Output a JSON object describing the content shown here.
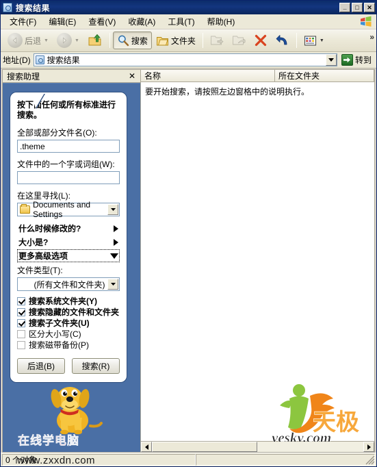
{
  "window": {
    "title": "搜索结果",
    "controls": {
      "minimize": "_",
      "maximize": "□",
      "close": "✕"
    }
  },
  "menu": {
    "items": [
      {
        "label": "文件(F)"
      },
      {
        "label": "编辑(E)"
      },
      {
        "label": "查看(V)"
      },
      {
        "label": "收藏(A)"
      },
      {
        "label": "工具(T)"
      },
      {
        "label": "帮助(H)"
      }
    ]
  },
  "toolbar": {
    "back_label": "后退",
    "search_label": "搜索",
    "folders_label": "文件夹",
    "more_chevron": "»",
    "icons": {
      "back": "back-arrow-icon",
      "forward": "forward-arrow-icon",
      "up": "up-folder-icon",
      "search": "magnifier-icon",
      "folders": "folder-icon",
      "move_to": "move-to-folder-icon",
      "copy_to": "copy-to-folder-icon",
      "delete": "delete-x-icon",
      "undo": "undo-arrow-icon",
      "views": "views-grid-icon"
    }
  },
  "address": {
    "label": "地址(D)",
    "value": "搜索结果",
    "go_label": "转到"
  },
  "search_pane": {
    "header_title": "搜索助理",
    "close_glyph": "✕",
    "instruction": "按下面任何或所有标准进行搜索。",
    "filename_label": "全部或部分文件名(O):",
    "filename_value": ".theme",
    "word_label": "文件中的一个字或词组(W):",
    "word_value": "",
    "lookin_label": "在这里寻找(L):",
    "lookin_value": "Documents and Settings",
    "when_modified": "什么时候修改的?",
    "what_size": "大小是?",
    "more_advanced": "更多高级选项",
    "filetype_label": "文件类型(T):",
    "filetype_value": "(所有文件和文件夹)",
    "checkboxes": [
      {
        "label": "搜索系统文件夹(Y)",
        "checked": true,
        "bold": true,
        "dim": false
      },
      {
        "label": "搜索隐藏的文件和文件夹",
        "checked": true,
        "bold": true,
        "dim": false
      },
      {
        "label": "搜索子文件夹(U)",
        "checked": true,
        "bold": true,
        "dim": false
      },
      {
        "label": "区分大小写(C)",
        "checked": false,
        "bold": false,
        "dim": true
      },
      {
        "label": "搜索磁带备份(P)",
        "checked": false,
        "bold": false,
        "dim": true
      }
    ],
    "back_button": "后退(B)",
    "search_button": "搜索(R)"
  },
  "list_pane": {
    "columns": [
      {
        "label": "名称"
      },
      {
        "label": "所在文件夹"
      }
    ],
    "empty_message": "要开始搜索，请按照左边窗格中的说明执行。"
  },
  "status_bar": {
    "left_text": "0 个对象",
    "right_text": ""
  },
  "watermarks": {
    "bottom_left_text": "在线学电脑",
    "bottom_left_url": "www.zxxdn.com",
    "bottom_right_text": "yesky.com",
    "bottom_right_logo": "天极"
  },
  "colors": {
    "titlebar": "#0c2d6b",
    "pane_blue": "#4a6fa5",
    "toolbar_bg": "#ece9d8",
    "accent_green": "#4fa04f",
    "delete_red": "#d9431f",
    "undo_blue": "#1d4e9c",
    "logo_orange": "#f08519",
    "logo_green": "#8cc63f"
  }
}
